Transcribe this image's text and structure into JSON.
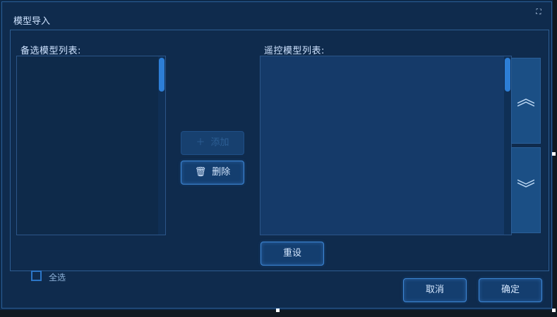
{
  "dialog": {
    "title": "模型导入",
    "maximize_icon": "maximize-icon"
  },
  "left": {
    "label": "备选模型列表:",
    "items": [],
    "select_all": "全选"
  },
  "right": {
    "label": "遥控模型列表:",
    "items": [],
    "move_up_icon": "double-chevron-up-icon",
    "move_down_icon": "double-chevron-down-icon"
  },
  "buttons": {
    "add": "添加",
    "delete": "删除",
    "reset": "重设",
    "cancel": "取消",
    "confirm": "确定"
  },
  "colors": {
    "background": "#0f2b4d",
    "border": "#2d5d92",
    "accent": "#2d7ed6"
  }
}
